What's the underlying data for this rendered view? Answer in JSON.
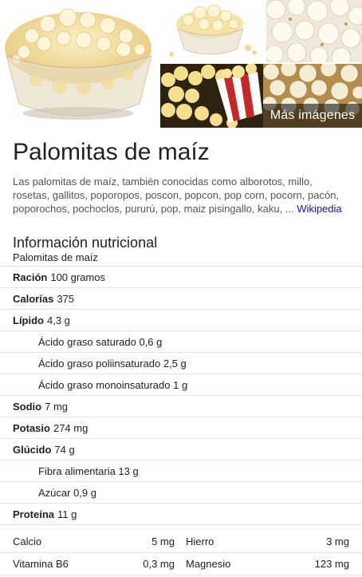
{
  "images": {
    "more_label": "Más imágenes"
  },
  "entity": {
    "title": "Palomitas de maíz",
    "description": "Las palomitas de maíz, también conocidas como alborotos, millo, rosetas, gallitos, poporopos, poscon, popcon, pop corn, pocorn, pacón, poporochos, pochoclos, pururú, pop, maiz pisingallo, kaku, ...",
    "source_link": "Wikipedia"
  },
  "nutrition": {
    "heading": "Información nutricional",
    "subheading": "Palomitas de maíz",
    "rows": [
      {
        "label": "Ración",
        "value": "100 gramos"
      },
      {
        "label": "Calorías",
        "value": "375"
      },
      {
        "label": "Lípido",
        "value": "4,3 g"
      },
      {
        "label": "",
        "value": "Ácido graso saturado 0,6 g"
      },
      {
        "label": "",
        "value": "Ácido graso poliinsaturado 2,5 g"
      },
      {
        "label": "",
        "value": "Ácido graso monoinsaturado 1 g"
      },
      {
        "label": "Sodio",
        "value": "7 mg"
      },
      {
        "label": "Potasio",
        "value": "274 mg"
      },
      {
        "label": "Glúcido",
        "value": "74 g"
      },
      {
        "label": "",
        "value": "Fibra alimentaria 13 g"
      },
      {
        "label": "",
        "value": "Azúcar 0,9 g"
      },
      {
        "label": "Proteína",
        "value": "11 g"
      }
    ],
    "minerals": [
      {
        "left_name": "Calcio",
        "left_value": "5 mg",
        "right_name": "Hierro",
        "right_value": "3 mg"
      },
      {
        "left_name": "Vitamina B6",
        "left_value": "0,3 mg",
        "right_name": "Magnesio",
        "right_value": "123 mg"
      }
    ]
  }
}
